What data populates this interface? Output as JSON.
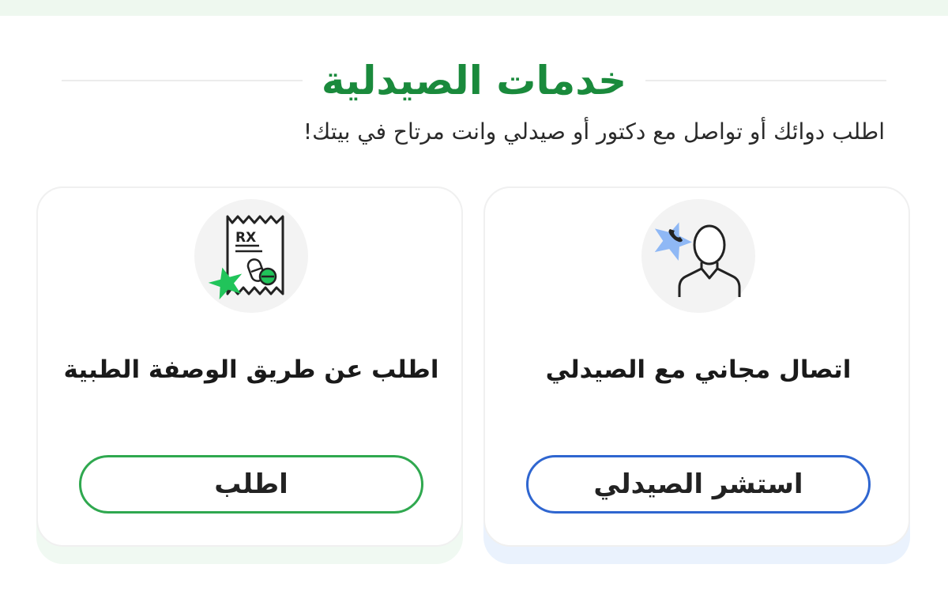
{
  "header": {
    "title": "خدمات الصيدلية",
    "subtitle": "اطلب دوائك أو تواصل مع دكتور أو صيدلي وانت مرتاح في بيتك!"
  },
  "cards": {
    "prescription": {
      "icon": "prescription-icon",
      "rx_text": "RX",
      "title": "اطلب عن طريق الوصفة الطبية",
      "button_label": "اطلب",
      "accent": "#2fa84f"
    },
    "pharmacist": {
      "icon": "pharmacist-call-icon",
      "title": "اتصال مجاني مع الصيدلي",
      "button_label": "استشر الصيدلي",
      "accent": "#2f66d0"
    }
  },
  "colors": {
    "brand_green": "#1a8a3c",
    "green_outline": "#2fa84f",
    "blue_outline": "#2f66d0",
    "star_green": "#21c45a",
    "star_blue": "#8fb8f5"
  }
}
